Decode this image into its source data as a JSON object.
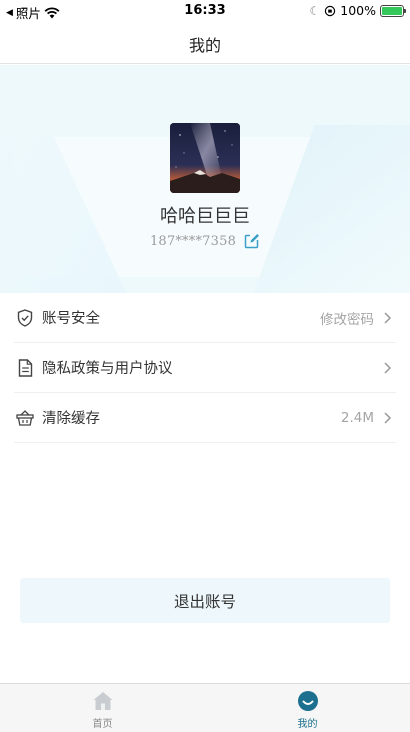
{
  "status_bar": {
    "back_app": "照片",
    "time": "16:33",
    "battery_percent": "100%",
    "battery_level": 1.0
  },
  "nav": {
    "title": "我的"
  },
  "profile": {
    "username": "哈哈巨巨巨",
    "phone": "187****7358"
  },
  "menu": {
    "items": [
      {
        "icon": "shield-icon",
        "label": "账号安全",
        "value": "修改密码"
      },
      {
        "icon": "document-icon",
        "label": "隐私政策与用户协议",
        "value": ""
      },
      {
        "icon": "basket-icon",
        "label": "清除缓存",
        "value": "2.4M"
      }
    ]
  },
  "logout": {
    "label": "退出账号"
  },
  "tabs": [
    {
      "icon": "home-icon",
      "label": "首页",
      "active": false
    },
    {
      "icon": "smile-icon",
      "label": "我的",
      "active": true
    }
  ],
  "colors": {
    "accent": "#1c6f8e",
    "header_bg": "#eef9fc",
    "logout_bg": "#eef8fc",
    "edit_icon": "#3aa0c6"
  }
}
